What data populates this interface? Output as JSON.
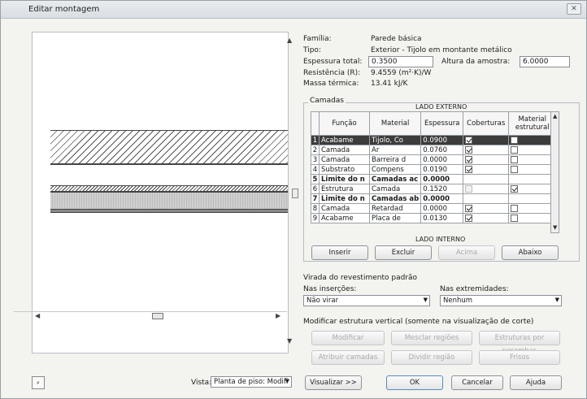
{
  "window": {
    "title": "Editar montagem",
    "close_label": "✕"
  },
  "props": {
    "familia_label": "Família:",
    "familia_value": "Parede básica",
    "tipo_label": "Tipo:",
    "tipo_value": "Exterior - Tijolo em montante metálico",
    "espessura_label": "Espessura total:",
    "espessura_value": "0.3500",
    "altura_label": "Altura da amostra:",
    "altura_value": "6.0000",
    "resistencia_label": "Resistência (R):",
    "resistencia_value": "9.4559 (m²·K)/W",
    "massa_label": "Massa térmica:",
    "massa_value": "13.41 kJ/K"
  },
  "layers": {
    "title": "Camadas",
    "exterior_label": "LADO EXTERNO",
    "interior_label": "LADO INTERNO",
    "headers": [
      "Função",
      "Material",
      "Espessura",
      "Coberturas",
      "Material estrutural"
    ],
    "rows": [
      {
        "n": "1",
        "funcao": "Acabame",
        "material": "Tijolo, Co",
        "espessura": "0.0900",
        "cob": "on",
        "est": "off",
        "sel": true,
        "bold": false
      },
      {
        "n": "2",
        "funcao": "Camada",
        "material": "Ar",
        "espessura": "0.0760",
        "cob": "on",
        "est": "off",
        "sel": false,
        "bold": false
      },
      {
        "n": "3",
        "funcao": "Camada",
        "material": "Barreira d",
        "espessura": "0.0000",
        "cob": "on",
        "est": "off",
        "sel": false,
        "bold": false
      },
      {
        "n": "4",
        "funcao": "Substrato",
        "material": "Compens",
        "espessura": "0.0190",
        "cob": "on",
        "est": "off",
        "sel": false,
        "bold": false
      },
      {
        "n": "5",
        "funcao": "Limite do n",
        "material": "Camadas ac",
        "espessura": "0.0000",
        "cob": "none",
        "est": "none",
        "sel": false,
        "bold": true
      },
      {
        "n": "6",
        "funcao": "Estrutura",
        "material": "Camada",
        "espessura": "0.1520",
        "cob": "dis",
        "est": "on",
        "sel": false,
        "bold": false
      },
      {
        "n": "7",
        "funcao": "Limite do n",
        "material": "Camadas ab",
        "espessura": "0.0000",
        "cob": "none",
        "est": "none",
        "sel": false,
        "bold": true
      },
      {
        "n": "8",
        "funcao": "Camada",
        "material": "Retardad",
        "espessura": "0.0000",
        "cob": "on",
        "est": "off",
        "sel": false,
        "bold": false
      },
      {
        "n": "9",
        "funcao": "Acabame",
        "material": "Placa de",
        "espessura": "0.0130",
        "cob": "on",
        "est": "off",
        "sel": false,
        "bold": false
      }
    ]
  },
  "buttons": {
    "inserir": "Inserir",
    "excluir": "Excluir",
    "acima": "Acima",
    "abaixo": "Abaixo",
    "modificar": "Modificar",
    "mesclar": "Mesclar regiões",
    "estrutura": "Estruturas por perambas",
    "atribuir": "Atribuir camadas",
    "dividir": "Dividir região",
    "frisos": "Frisos",
    "visualizar": "Visualizar >>",
    "ok": "OK",
    "cancelar": "Cancelar",
    "ajuda": "Ajuda"
  },
  "wrap": {
    "title": "Virada do revestimento padrão",
    "insercoes_label": "Nas inserções:",
    "insercoes_value": "Não virar",
    "extremidades_label": "Nas extremidades:",
    "extremidades_value": "Nenhum"
  },
  "vertical": {
    "title": "Modificar estrutura vertical (somente na visualização de corte)"
  },
  "footer": {
    "vista_label": "Vista:",
    "vista_value": "Planta de piso: Modifi"
  }
}
